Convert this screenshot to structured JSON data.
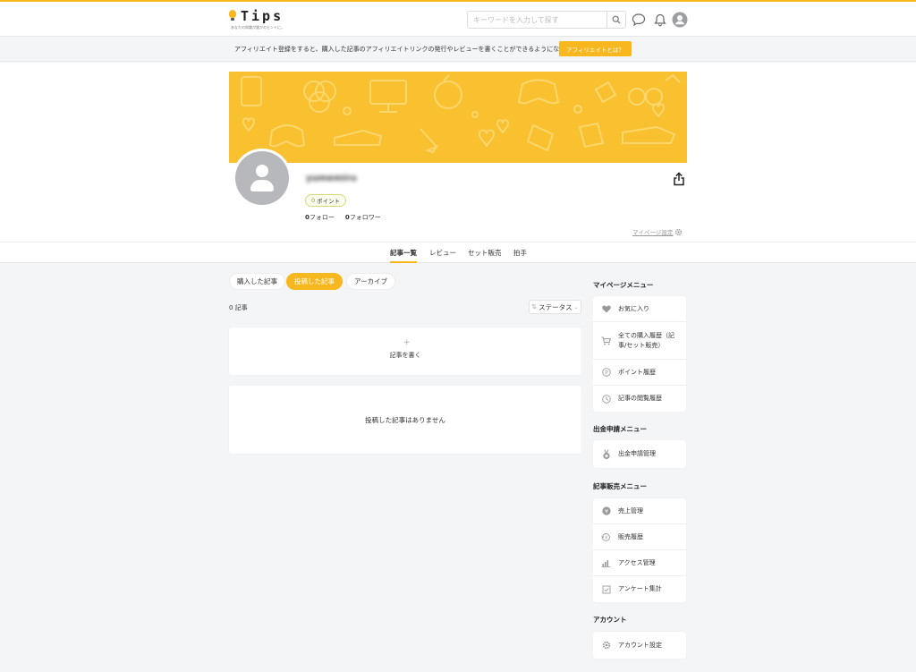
{
  "brand": {
    "name": "Tips",
    "tagline": "あなたの知識が誰かのヒントに。",
    "accent": "#f7b81f"
  },
  "header": {
    "search": {
      "placeholder": "キーワードを入力して探す",
      "value": ""
    },
    "icons": [
      "search-icon",
      "chat-bubble-icon",
      "bell-icon",
      "user-avatar-icon"
    ]
  },
  "affiliate": {
    "text": "アフィリエイト登録をすると、購入した記事のアフィリエイトリンクの発行やレビューを書くことができるようになります。",
    "button": "アフィリエイトとは？"
  },
  "profile": {
    "username": "yumemiru",
    "points_value": "0",
    "points_label": "ポイント",
    "follow_count": "0",
    "follow_label": "フォロー",
    "follower_count": "0",
    "follower_label": "フォロワー",
    "settings_link": "マイページ設定"
  },
  "tabs": [
    {
      "label": "記事一覧",
      "active": true
    },
    {
      "label": "レビュー",
      "active": false
    },
    {
      "label": "セット販売",
      "active": false
    },
    {
      "label": "拍手",
      "active": false
    }
  ],
  "subtabs": [
    {
      "label": "購入した記事",
      "active": false
    },
    {
      "label": "投稿した記事",
      "active": true
    },
    {
      "label": "アーカイブ",
      "active": false
    }
  ],
  "article_count": "0 記事",
  "status_sort": "ステータス",
  "write_card": {
    "label": "記事を書く"
  },
  "empty_card": {
    "label": "投稿した記事はありません"
  },
  "sidebar": {
    "mypage_menu": {
      "title": "マイページメニュー",
      "items": [
        {
          "label": "お気に入り",
          "icon": "heart-icon"
        },
        {
          "label": "全ての購入履歴（記事/セット販売）",
          "icon": "cart-icon"
        },
        {
          "label": "ポイント履歴",
          "icon": "point-icon"
        },
        {
          "label": "記事の閲覧履歴",
          "icon": "clock-icon"
        }
      ]
    },
    "payout_menu": {
      "title": "出金申請メニュー",
      "items": [
        {
          "label": "出金申請管理",
          "icon": "medal-icon"
        }
      ]
    },
    "sales_menu": {
      "title": "記事販売メニュー",
      "items": [
        {
          "label": "売上管理",
          "icon": "yen-icon"
        },
        {
          "label": "販売履歴",
          "icon": "sales-history-icon"
        },
        {
          "label": "アクセス管理",
          "icon": "bar-chart-icon"
        },
        {
          "label": "アンケート集計",
          "icon": "survey-icon"
        }
      ]
    },
    "account_menu": {
      "title": "アカウント",
      "items": [
        {
          "label": "アカウント設定",
          "icon": "gear-icon"
        }
      ]
    }
  }
}
